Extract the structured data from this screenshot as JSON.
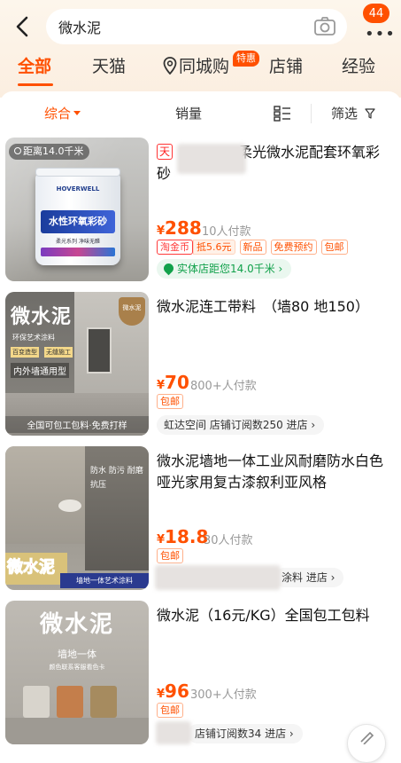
{
  "search": {
    "query": "微水泥",
    "badge_count": "44"
  },
  "tabs": [
    "全部",
    "天猫",
    "同城购",
    "店铺",
    "经验"
  ],
  "tab_special_badge": "特惠",
  "filters": {
    "sort": "综合",
    "sales": "销量",
    "filter": "筛选"
  },
  "accent_color": "#ff5000",
  "products": [
    {
      "platform_tag": "天",
      "title": "柔光微水泥配套环氧彩砂",
      "price": "288",
      "paid": "10人付款",
      "tags": [
        "淘金币",
        "抵5.6元",
        "新品",
        "免费预约",
        "包邮"
      ],
      "shop": "实体店距您14.0千米",
      "image_text": {
        "distance": "距离14.0千米",
        "brand": "HOVERWELL",
        "product": "水性环氧彩砂",
        "tagline": "柔光系列 净味无醛"
      }
    },
    {
      "title": "微水泥连工带料　（墙80 地150）",
      "price": "70",
      "paid": "800+人付款",
      "tags": [
        "包邮"
      ],
      "shop": "虹达空间 店铺订阅数250 进店",
      "image_text": {
        "big": "微水泥",
        "line1": "环保艺术涂料",
        "chip1": "百变造型",
        "chip2": "无缝施工",
        "line2": "内外墙通用型",
        "bottom": "全国可包工包料·免费打样",
        "seal": "微水泥"
      }
    },
    {
      "title": "微水泥墙地一体工业风耐磨防水白色哑光家用复古漆叙利亚风格",
      "price": "18.8",
      "paid": "30人付款",
      "tags": [
        "包邮"
      ],
      "shop": "涂料 进店",
      "image_text": {
        "side": "防水 防污 耐磨 抗压",
        "logo": "微水泥",
        "band": "墙地一体艺术涂料"
      }
    },
    {
      "title": "微水泥（16元/KG）全国包工包料",
      "price": "96",
      "paid": "300+人付款",
      "tags": [
        "包邮"
      ],
      "shop": "店铺订阅数34 进店",
      "image_text": {
        "big": "微水泥",
        "line1": "墙地一体",
        "line2": "颜色联系客服看色卡"
      }
    }
  ]
}
